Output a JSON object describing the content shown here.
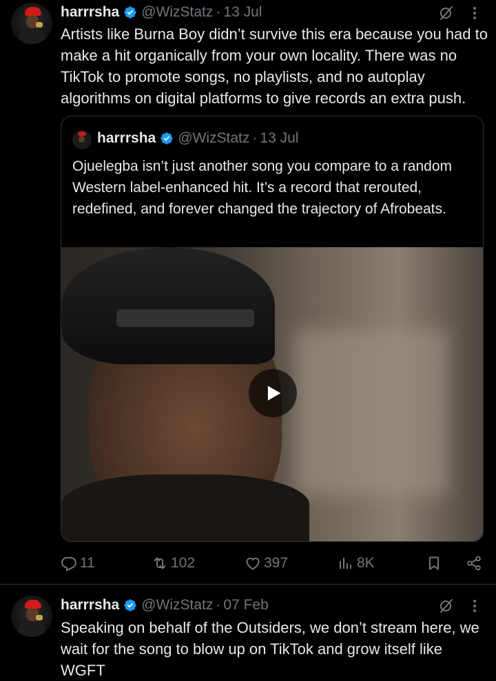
{
  "colors": {
    "background": "#000000",
    "text": "#e7e9ea",
    "secondary": "#71767b",
    "verified": "#1d9bf0",
    "border": "#2f3336"
  },
  "tweets": [
    {
      "name": "harrrsha",
      "handle": "@WizStatz",
      "dot": "·",
      "date": "13 Jul",
      "text": "Artists like Burna Boy didn’t survive this era because you had to make a hit organically from your own locality. There was no TikTok to promote songs, no playlists, and no autoplay algorithms on digital platforms to give records an extra push.",
      "quote": {
        "name": "harrrsha",
        "handle": "@WizStatz",
        "dot": "·",
        "date": "13 Jul",
        "text": "Ojuelegba isn’t just another song you compare to a random Western label-enhanced hit. It’s a record that rerouted, redefined, and forever changed the trajectory of Afrobeats.",
        "media": "video"
      },
      "stats": {
        "replies": "11",
        "reposts": "102",
        "likes": "397",
        "views": "8K"
      }
    },
    {
      "name": "harrrsha",
      "handle": "@WizStatz",
      "dot": "·",
      "date": "07 Feb",
      "text": "Speaking on behalf of the Outsiders, we don’t stream here, we wait for the song to blow up on TikTok and grow itself like WGFT"
    }
  ],
  "icons": [
    "verified-badge-icon",
    "grok-icon",
    "more-icon",
    "play-icon",
    "reply-icon",
    "repost-icon",
    "like-icon",
    "views-icon",
    "bookmark-icon",
    "share-icon"
  ]
}
